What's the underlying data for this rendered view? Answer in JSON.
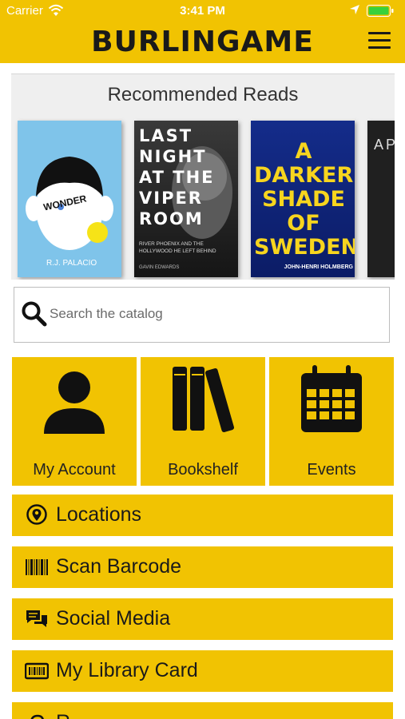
{
  "status_bar": {
    "carrier": "Carrier",
    "time": "3:41 PM"
  },
  "header": {
    "brand": "BURLINGAME"
  },
  "recommended": {
    "title": "Recommended Reads",
    "books": [
      {
        "cover_text": "WONDER",
        "author": "R.J. PALACIO"
      },
      {
        "cover_text": "LAST NIGHT AT THE VIPER ROOM",
        "subtitle": "RIVER PHOENIX AND THE HOLLYWOOD HE LEFT BEHIND",
        "author": "GAVIN EDWARDS"
      },
      {
        "cover_text": "A DARKER SHADE OF SWEDEN",
        "author": "JOHN-HENRI HOLMBERG"
      },
      {
        "cover_text": "AP"
      }
    ]
  },
  "search": {
    "placeholder": "Search the catalog"
  },
  "tiles": [
    {
      "label": "My Account",
      "icon": "person-icon"
    },
    {
      "label": "Bookshelf",
      "icon": "books-icon"
    },
    {
      "label": "Events",
      "icon": "calendar-icon"
    }
  ],
  "rows": [
    {
      "label": "Locations",
      "icon": "map-pin-icon"
    },
    {
      "label": "Scan Barcode",
      "icon": "barcode-icon"
    },
    {
      "label": "Social Media",
      "icon": "chat-bubbles-icon"
    },
    {
      "label": "My Library Card",
      "icon": "library-card-icon"
    },
    {
      "label": "R",
      "icon": "cloud-icon"
    }
  ],
  "colors": {
    "brand_yellow": "#f1c302",
    "text_dark": "#1a1a1a"
  }
}
